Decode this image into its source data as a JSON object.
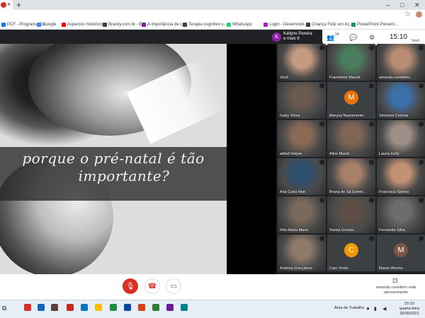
{
  "browser": {
    "new_tab_glyph": "+",
    "close_glyph": "×",
    "minimize_glyph": "–",
    "maximize_glyph": "□",
    "window_close_glyph": "✕",
    "star_glyph": "☆"
  },
  "bookmarks": [
    {
      "label": "PCF - Programa Cri...",
      "color": "#1a73e8"
    },
    {
      "label": "Google",
      "color": "#4285f4"
    },
    {
      "label": "Aspectos históricos...",
      "color": "#ff0000"
    },
    {
      "label": "Brainly.com.br - Est...",
      "color": "#3c4043"
    },
    {
      "label": "A importância de c...",
      "color": "#7b1fa2"
    },
    {
      "label": "Terapia cognitivo c...",
      "color": "#3c4043"
    },
    {
      "label": "WhatsApp",
      "color": "#25d366"
    },
    {
      "label": "Login - Desenvolvi...",
      "color": "#9c27b0"
    },
    {
      "label": "Criança Feliz em Aç...",
      "color": "#3c4043"
    },
    {
      "label": "PowerPoint Present...",
      "color": "#0f9d58"
    }
  ],
  "presenter": {
    "initial": "K",
    "name_line1": "Kallyne Pereira",
    "name_line2": "e mais 6"
  },
  "toolbar": {
    "participants_count": "24",
    "clock": "15:10",
    "you_label": "Você"
  },
  "slide": {
    "line1": "porque o pré-natal é tão",
    "line2": "importante?"
  },
  "participants": [
    {
      "name": "Você",
      "type": "cam",
      "bg": "#c49a82"
    },
    {
      "name": "Francilene Maciel",
      "type": "cam",
      "bg": "#4a7d5c"
    },
    {
      "name": "amanda coredeiro",
      "type": "cam",
      "bg": "#b98c74"
    },
    {
      "name": "Gaby Shiva",
      "type": "cam",
      "bg": "#6b5a4f"
    },
    {
      "name": "Marysa Nascimento",
      "type": "initial",
      "initial": "M",
      "color": "#e8710a"
    },
    {
      "name": "Simones Correia",
      "type": "cam",
      "bg": "#3d6fa8"
    },
    {
      "name": "adriell lirique",
      "type": "cam",
      "bg": "#8a6a55"
    },
    {
      "name": "Aline Muniz",
      "type": "cam",
      "bg": "#7f6555"
    },
    {
      "name": "Launa Kelly",
      "type": "cam",
      "bg": "#9e8f86"
    },
    {
      "name": "Ana Carla Noé",
      "type": "cam",
      "bg": "#2f4f6f"
    },
    {
      "name": "Bruna de Sá Esmer...",
      "type": "cam",
      "bg": "#a8806a"
    },
    {
      "name": "Francisca Santos",
      "type": "cam",
      "bg": "#c29072"
    },
    {
      "name": "Rita Maria Maria",
      "type": "cam",
      "bg": "#7a6a5c"
    },
    {
      "name": "Samia Gomes",
      "type": "cam",
      "bg": "#5c4e45"
    },
    {
      "name": "Fernanda Silva",
      "type": "cam",
      "bg": "#6d6d6d"
    },
    {
      "name": "Antônia Gonçalves",
      "type": "cam",
      "bg": "#8f7a6a"
    },
    {
      "name": "Caio Victor",
      "type": "initial",
      "initial": "C",
      "color": "#f29900"
    },
    {
      "name": "Maria Vitorino",
      "type": "initial",
      "initial": "M",
      "color": "#795548"
    }
  ],
  "controls": {
    "mic_glyph": "🎙",
    "hangup_glyph": "☎",
    "camera_glyph": "▭",
    "presenting_glyph": "⊡",
    "presenting_text": "amanda coredeiro está apresentando"
  },
  "taskbar": {
    "area_label": "Área de Trabalho",
    "time": "15:10",
    "day": "quarta-feira",
    "date": "26/05/2021",
    "apps": [
      {
        "color": "#d32f2f"
      },
      {
        "color": "#1565c0"
      },
      {
        "color": "#5d4037"
      },
      {
        "color": "#c62828"
      },
      {
        "color": "#0277bd"
      },
      {
        "color": "#fbbc04"
      },
      {
        "color": "#1e8e3e"
      },
      {
        "color": "#0d47a1"
      },
      {
        "color": "#d84315"
      },
      {
        "color": "#2e7d32"
      },
      {
        "color": "#6a1b9a"
      },
      {
        "color": "#00838f"
      }
    ]
  }
}
